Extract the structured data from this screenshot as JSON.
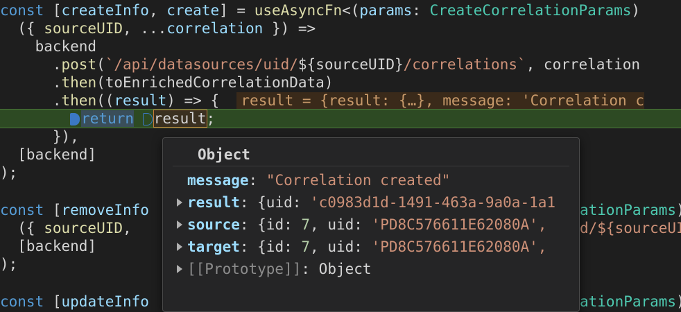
{
  "code": {
    "line1": {
      "const": "const",
      "open": " [",
      "createInfo": "createInfo",
      "comma": ", ",
      "create": "create",
      "close": "] = ",
      "fn": "useAsyncFn",
      "lt": "<(",
      "params": "params",
      "colon": ": ",
      "type": "CreateCorrelationParams",
      "rest": ")"
    },
    "line2": {
      "indent": "  ({ ",
      "sourceUID": "sourceUID",
      "comma": ", ...",
      "correlation": "correlation",
      "rest": " }) =>"
    },
    "line3": {
      "text": "    backend"
    },
    "line4": {
      "indent": "      .",
      "post": "post",
      "open": "(",
      "str1": "`/api/datasources/uid/",
      "tmpl": "${sourceUID}",
      "str2": "/correlations`",
      "rest": ", correlation"
    },
    "line5": {
      "indent": "      .",
      "then": "then",
      "rest": "(toEnrichedCorrelationData)"
    },
    "line6": {
      "indent": "      .",
      "then": "then",
      "open": "((",
      "result": "result",
      "rest": ") => {  ",
      "hint": "result = {result: {…}, message: 'Correlation c"
    },
    "line7": {
      "indent": "        ",
      "return": "return",
      "space": " ",
      "res": "result",
      "semi": ";"
    },
    "line8": {
      "text": "      }),"
    },
    "line9": {
      "text": "  [backend]"
    },
    "line10": {
      "text": ");"
    },
    "line12": {
      "const": "const",
      "open": " [",
      "name": "removeInfo",
      "tail_type": "ationParams",
      "tail_rest": ")"
    },
    "line13": {
      "indent": "  ({ ",
      "sourceUID": "sourceUID",
      "comma": ", ",
      "tail": "d/${sourceUI"
    },
    "line14": {
      "text": "  [backend]"
    },
    "line15": {
      "text": ");"
    },
    "line17": {
      "const": "const",
      "open": " [",
      "name": "updateInfo",
      "tail_type": "ationParams",
      "tail_rest": ")"
    }
  },
  "tooltip": {
    "title": "Object",
    "rows": [
      {
        "key": "message",
        "sep": ": ",
        "value": "\"Correlation created\"",
        "expandable": false
      },
      {
        "key": "result",
        "sep": ": ",
        "prefix": "{uid: ",
        "value": "'c0983d1d-1491-463a-9a0a-1a1",
        "expandable": true
      },
      {
        "key": "source",
        "sep": ": ",
        "prefix": "{id: ",
        "num": "7",
        "mid": ", uid: ",
        "value": "'PD8C576611E62080A',",
        "expandable": true
      },
      {
        "key": "target",
        "sep": ": ",
        "prefix": "{id: ",
        "num": "7",
        "mid": ", uid: ",
        "value": "'PD8C576611E62080A',",
        "expandable": true
      },
      {
        "key": "[[Prototype]]",
        "sep": ": ",
        "value": "Object",
        "expandable": true
      }
    ]
  },
  "colors": {
    "background": "#1e1e1e",
    "active_line": "#2d4a23",
    "keyword": "#569cd6",
    "type": "#4ec9b0",
    "string": "#ce9178"
  }
}
